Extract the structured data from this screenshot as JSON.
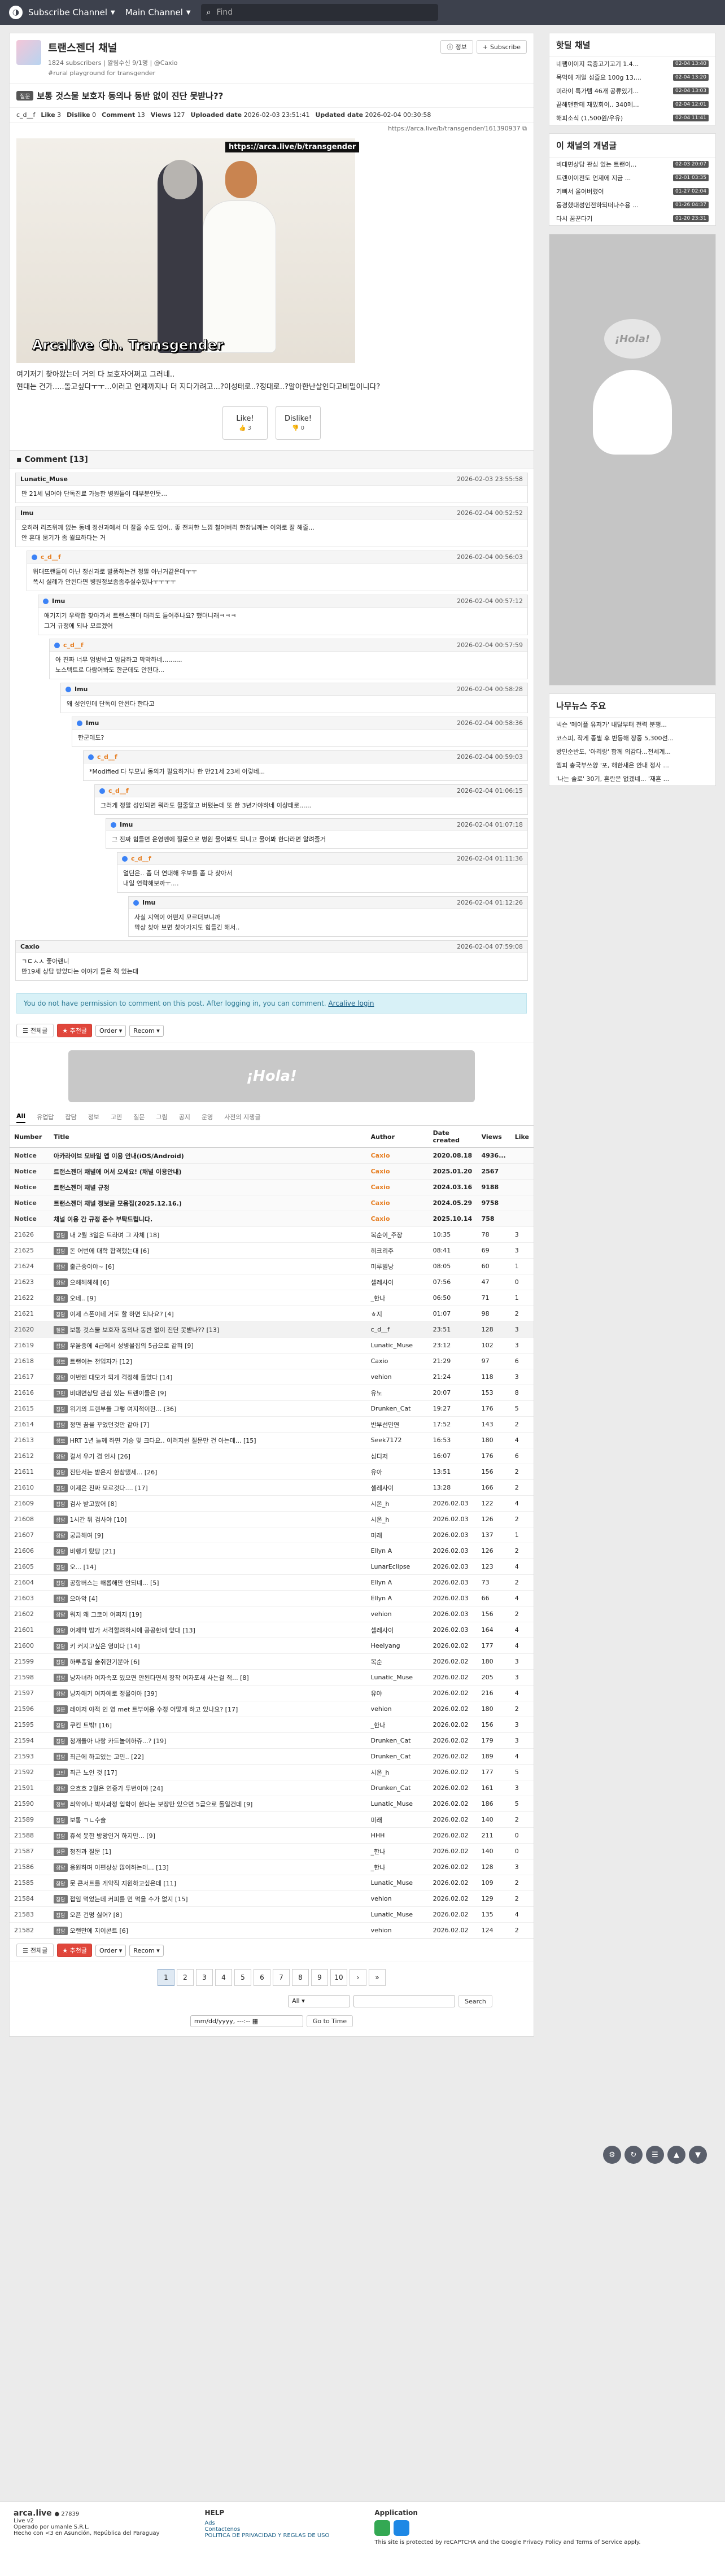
{
  "nav": {
    "subscribe": "Subscribe Channel",
    "main": "Main Channel",
    "search_placeholder": "Find"
  },
  "board": {
    "title": "트랜스젠더 채널",
    "subscribers": "1824 subscribers",
    "managers": "| 알림수신 9/1명 | @Caxio",
    "desc": "#rural playground for transgender",
    "btn_info": "정보",
    "btn_sub": "Subscribe"
  },
  "post": {
    "category": "질문",
    "title": "보통 것스물 보호자 동의나 동반 없이 진단 못받나??",
    "author": "c_d__f",
    "like_label": "Like",
    "like": "3",
    "dislike_label": "Dislike",
    "dislike": "0",
    "comment_label": "Comment",
    "comment": "13",
    "views_label": "Views",
    "views": "127",
    "uploaded_label": "Uploaded date",
    "uploaded": "2026-02-03 23:51:41",
    "updated_label": "Updated date",
    "updated": "2026-02-04 00:30:58",
    "link": "https://arca.live/b/transgender/161390937",
    "image_url_tag": "https://arca.live/b/transgender",
    "watermark": "Arcalive Ch. Transgender",
    "body_lines": [
      "여기저기 찾아봤는데 거의 다 보호자어쩌고 그러네..",
      "현대는 건가.....돌고싶다ㅜㅜ...이러고 언제까지나 더 지다가려고...?이성태로..?정대로..?알아한난살인다고비밀이니다?"
    ],
    "vote_like": "Like!",
    "vote_like_cnt": "3",
    "vote_dislike": "Dislike!",
    "vote_dislike_cnt": "0"
  },
  "comments": {
    "header": "Comment [13]",
    "items": [
      {
        "who": "Lunatic_Muse",
        "date": "2026-02-03 23:55:58",
        "text": "만 21세 넘어야 단독진료 가능한 병원들이 대부분인듯..."
      },
      {
        "who": "Imu",
        "date": "2026-02-04 00:52:52",
        "text": "오히려 리즈위께 없는 동네 정신과에서 더 잘줄 수도 있어.. 좋 전처한 느낌 철어버리 한참님께는 이와로 잘 해줄...\n안 혼대 뭄기가 좀 월요하다는 거"
      },
      {
        "who": "c_d__f",
        "date": "2026-02-04 00:56:03",
        "text": "위대뜨랜들이 아닌 정신과로 발품하는건 정말 아닌거같은데ㅜㅜ\n폭시 실례가 안된다면 병원정보좀좀주실수있나ㅜㅜㅜㅜ"
      },
      {
        "who": "Imu",
        "date": "2026-02-04 00:57:12",
        "text": "애기지기 우락합 찾아가서 트랜스젠더 대리도 들어주나요? 했더니래ㅋㅋㅋ\n그거 규정에 되나 모르겠어"
      },
      {
        "who": "c_d__f",
        "date": "2026-02-04 00:57:59",
        "text": "아 진짜 너무 엄벙박고 암담하고 막막하네..........\n노스텍트로 다람어봐도 한군데도 안된다..."
      },
      {
        "who": "Imu",
        "date": "2026-02-04 00:58:28",
        "text": "왜 성인인데 단독이 안된다 한다고"
      },
      {
        "who": "Imu",
        "date": "2026-02-04 00:58:36",
        "text": "한군데도?"
      },
      {
        "who": "c_d__f",
        "date": "2026-02-04 00:59:03",
        "text": "*Modified 다 부모님 동의가 필요하거나 한 만21세 23세 이렇네..."
      },
      {
        "who": "c_d__f",
        "date": "2026-02-04 01:06:15",
        "text": "그러게 정말 성인되면 뭐라도 될줄알고 버텼는데 또 한 3년가야하네 이상태로......"
      },
      {
        "who": "Imu",
        "date": "2026-02-04 01:07:18",
        "text": "그 진짜 힘들면 운영엔에 질문으로 병원 물어봐도 되니고 물어봐 한다라면 알려줄거"
      },
      {
        "who": "c_d__f",
        "date": "2026-02-04 01:11:36",
        "text": "얼딘은.. 좀 더 연대해 우보를 좀 다 찾아서\n내일 연락해보까ㅜ...."
      },
      {
        "who": "Imu",
        "date": "2026-02-04 01:12:26",
        "text": "사실 지역이 어떤지 모르더보니까\n막상 찾아 보면 찾아가지도 힘들긴 해서.."
      },
      {
        "who": "Caxio",
        "date": "2026-02-04 07:59:08",
        "text": "ㄱㄷㅅㅅ 좋아랜니\n만19세 상담 받았다는 이야기 들은 적 있는대"
      }
    ]
  },
  "login_notice": {
    "text": "You do not have permission to comment on this post. After logging in, you can comment.",
    "link": "Arcalive login"
  },
  "toolbar": {
    "all": "전체글",
    "recommended": "추천글",
    "order": "Order",
    "recom": "Recom"
  },
  "ad_text": "¡Hola!",
  "tabs": [
    "All",
    "유업답",
    "잡담",
    "정보",
    "고민",
    "질문",
    "그림",
    "공지",
    "운영",
    "사전의 지쟁글"
  ],
  "list_headers": {
    "number": "Number",
    "title": "Title",
    "author": "Author",
    "date": "Date created",
    "views": "Views",
    "like": "Like"
  },
  "notices": [
    {
      "num": "Notice",
      "title": "아카라이브 모바일 앱 이용 안내(iOS/Android)",
      "author": "Caxio",
      "date": "2020.08.18",
      "views": "4936...",
      "like": ""
    },
    {
      "num": "Notice",
      "title": "트랜스젠더 채널에 어서 오세요! (채널 이용안내)",
      "author": "Caxio",
      "date": "2025.01.20",
      "views": "2567",
      "like": ""
    },
    {
      "num": "Notice",
      "title": "트랜스젠더 채널 규정",
      "author": "Caxio",
      "date": "2024.03.16",
      "views": "9188",
      "like": ""
    },
    {
      "num": "Notice",
      "title": "트랜스젠더 채널 정보글 모음집(2025.12.16.)",
      "author": "Caxio",
      "date": "2024.05.29",
      "views": "9758",
      "like": ""
    },
    {
      "num": "Notice",
      "title": "채널 이용 간 규정 준수 부탁드립니다.",
      "author": "Caxio",
      "date": "2025.10.14",
      "views": "758",
      "like": ""
    }
  ],
  "rows": [
    {
      "num": "21626",
      "cat": "잡담",
      "title": "내 2월 3일은 트라며 그 자체 [18]",
      "author": "복순이_주장",
      "date": "10:35",
      "views": "78",
      "like": "3"
    },
    {
      "num": "21625",
      "cat": "잡담",
      "title": "돈 어번에 대학 합격했는대 [6]",
      "author": "히크리주",
      "date": "08:41",
      "views": "69",
      "like": "3"
    },
    {
      "num": "21624",
      "cat": "잡담",
      "title": "출근중이야~ [6]",
      "author": "미루빌낭",
      "date": "08:05",
      "views": "60",
      "like": "1"
    },
    {
      "num": "21623",
      "cat": "잡담",
      "title": "으헤헤헤헤 [6]",
      "author": "셀레사이",
      "date": "07:56",
      "views": "47",
      "like": "0"
    },
    {
      "num": "21622",
      "cat": "잡담",
      "title": "오네.. [9]",
      "author": "_한나",
      "date": "06:50",
      "views": "71",
      "like": "1"
    },
    {
      "num": "21621",
      "cat": "잡담",
      "title": "이제 스폰이네 거도 할 하면 되나요? [4]",
      "author": "ㅎ지",
      "date": "01:07",
      "views": "98",
      "like": "2"
    },
    {
      "num": "21620",
      "cat": "질문",
      "title": "보통 것스물 보호자 동의나 동반 없이 진단 못받나?? [13]",
      "author": "c_d__f",
      "date": "23:51",
      "views": "128",
      "like": "3"
    },
    {
      "num": "21619",
      "cat": "잡담",
      "title": "우울증에 4급에서 성병몰집의 5급으로 같혀 [9]",
      "author": "Lunatic_Muse",
      "date": "23:12",
      "views": "102",
      "like": "3"
    },
    {
      "num": "21618",
      "cat": "정보",
      "title": "트랜이는 전업자가 [12]",
      "author": "Caxio",
      "date": "21:29",
      "views": "97",
      "like": "6"
    },
    {
      "num": "21617",
      "cat": "잡담",
      "title": "이번엔 대모가 되게 걱정해 돌았다 [14]",
      "author": "vehion",
      "date": "21:24",
      "views": "118",
      "like": "3"
    },
    {
      "num": "21616",
      "cat": "고민",
      "title": "비대면상담 관심 있는 트랜이들은 [9]",
      "author": "유노",
      "date": "20:07",
      "views": "153",
      "like": "8"
    },
    {
      "num": "21615",
      "cat": "잡담",
      "title": "위기의 트랜부들 그렇 여지적이한... [36]",
      "author": "Drunken_Cat",
      "date": "19:27",
      "views": "176",
      "like": "5"
    },
    {
      "num": "21614",
      "cat": "잡담",
      "title": "정면 꿈을 꾸었던것만 같아 [7]",
      "author": "반부선민연",
      "date": "17:52",
      "views": "143",
      "like": "2"
    },
    {
      "num": "21613",
      "cat": "정보",
      "title": "HRT 1년 늘께 하면 기승 및 크다요.. 이러지쉰 질문만 건 아는데... [15]",
      "author": "Seek7172",
      "date": "16:53",
      "views": "180",
      "like": "4"
    },
    {
      "num": "21612",
      "cat": "잡담",
      "title": "걸서 우기 겸 인사 [26]",
      "author": "심디저",
      "date": "16:07",
      "views": "176",
      "like": "6"
    },
    {
      "num": "21611",
      "cat": "잡담",
      "title": "진단서는 받은지 한참댔세... [26]",
      "author": "유아",
      "date": "13:51",
      "views": "156",
      "like": "2"
    },
    {
      "num": "21610",
      "cat": "잡담",
      "title": "이제은 친짜 모르것다.... [17]",
      "author": "셀레사이",
      "date": "13:28",
      "views": "166",
      "like": "2"
    },
    {
      "num": "21609",
      "cat": "잡담",
      "title": "검사 받고왔어 [8]",
      "author": "시온_h",
      "date": "2026.02.03",
      "views": "122",
      "like": "4"
    },
    {
      "num": "21608",
      "cat": "잡담",
      "title": "1시간 뒤 검사야 [10]",
      "author": "시온_h",
      "date": "2026.02.03",
      "views": "126",
      "like": "2"
    },
    {
      "num": "21607",
      "cat": "잡담",
      "title": "궁금해여 [9]",
      "author": "미래",
      "date": "2026.02.03",
      "views": "137",
      "like": "1"
    },
    {
      "num": "21606",
      "cat": "잡담",
      "title": "비행기 탔당 [21]",
      "author": "Ellyn A",
      "date": "2026.02.03",
      "views": "126",
      "like": "2"
    },
    {
      "num": "21605",
      "cat": "잡담",
      "title": "오... [14]",
      "author": "LunarEclipse",
      "date": "2026.02.03",
      "views": "123",
      "like": "4"
    },
    {
      "num": "21604",
      "cat": "잡담",
      "title": "공항버스는 해롭해만 안되네... [5]",
      "author": "Ellyn A",
      "date": "2026.02.03",
      "views": "73",
      "like": "2"
    },
    {
      "num": "21603",
      "cat": "잡담",
      "title": "으아악 [4]",
      "author": "Ellyn A",
      "date": "2026.02.03",
      "views": "66",
      "like": "4"
    },
    {
      "num": "21602",
      "cat": "잡담",
      "title": "워지 왜 그코이 어쩌지 [19]",
      "author": "vehion",
      "date": "2026.02.03",
      "views": "156",
      "like": "2"
    },
    {
      "num": "21601",
      "cat": "잡담",
      "title": "어제막 밤가 서격할려하시에 공공한께 앞대 [13]",
      "author": "셀레사이",
      "date": "2026.02.03",
      "views": "164",
      "like": "4"
    },
    {
      "num": "21600",
      "cat": "잡담",
      "title": "키 커지고싶은 영미다 [14]",
      "author": "Heelyang",
      "date": "2026.02.02",
      "views": "177",
      "like": "4"
    },
    {
      "num": "21599",
      "cat": "잡담",
      "title": "하루종일 술취한기분아 [6]",
      "author": "복순",
      "date": "2026.02.02",
      "views": "180",
      "like": "3"
    },
    {
      "num": "21598",
      "cat": "잡담",
      "title": "낭자녀라 여자속포 있으면 안된다면서 장착 여자포새 사는걸 적... [8]",
      "author": "Lunatic_Muse",
      "date": "2026.02.02",
      "views": "205",
      "like": "3"
    },
    {
      "num": "21597",
      "cat": "잡담",
      "title": "낭자애기 여자에로 정물이아 [39]",
      "author": "유야",
      "date": "2026.02.02",
      "views": "216",
      "like": "4"
    },
    {
      "num": "21596",
      "cat": "질문",
      "title": "레이저 야적 인 영 met 트부이용 수정 어떻게 하고 있나요? [17]",
      "author": "vehion",
      "date": "2026.02.02",
      "views": "180",
      "like": "2"
    },
    {
      "num": "21595",
      "cat": "잡담",
      "title": "쿠킨 트밖! [16]",
      "author": "_한나",
      "date": "2026.02.02",
      "views": "156",
      "like": "3"
    },
    {
      "num": "21594",
      "cat": "잡담",
      "title": "청개들아 나랑 카드놀이하쥬...? [19]",
      "author": "Drunken_Cat",
      "date": "2026.02.02",
      "views": "179",
      "like": "3"
    },
    {
      "num": "21593",
      "cat": "잡담",
      "title": "최근에 하고있는 고민.. [22]",
      "author": "Drunken_Cat",
      "date": "2026.02.02",
      "views": "189",
      "like": "4"
    },
    {
      "num": "21592",
      "cat": "고민",
      "title": "최근 노인 것 [17]",
      "author": "시온_h",
      "date": "2026.02.02",
      "views": "177",
      "like": "5"
    },
    {
      "num": "21591",
      "cat": "잡담",
      "title": "으흐흐 2월은 연중가 두번이야 [24]",
      "author": "Drunken_Cat",
      "date": "2026.02.02",
      "views": "161",
      "like": "3"
    },
    {
      "num": "21590",
      "cat": "정보",
      "title": "최악이나 박사과정 입학이 한다는 보장만 있으면 5급으로 돌일건데 [9]",
      "author": "Lunatic_Muse",
      "date": "2026.02.02",
      "views": "186",
      "like": "5"
    },
    {
      "num": "21589",
      "cat": "잡담",
      "title": "보통 ㄱㄴ수술",
      "author": "미래",
      "date": "2026.02.02",
      "views": "140",
      "like": "2"
    },
    {
      "num": "21588",
      "cat": "잡담",
      "title": "휴석 못한 방망인거 하지만... [9]",
      "author": "HHH",
      "date": "2026.02.02",
      "views": "211",
      "like": "0"
    },
    {
      "num": "21587",
      "cat": "질문",
      "title": "청진과 질문 [1]",
      "author": "_한나",
      "date": "2026.02.02",
      "views": "140",
      "like": "0"
    },
    {
      "num": "21586",
      "cat": "잡담",
      "title": "응원하며 이편상상 많이하는데... [13]",
      "author": "_한나",
      "date": "2026.02.02",
      "views": "128",
      "like": "3"
    },
    {
      "num": "21585",
      "cat": "잡담",
      "title": "뭇 큰서트를 게약직 지원하고싶은데 [11]",
      "author": "Lunatic_Muse",
      "date": "2026.02.02",
      "views": "109",
      "like": "2"
    },
    {
      "num": "21584",
      "cat": "잡담",
      "title": "접임 먹었는데 커피를 먼 먹을 수가 없지 [15]",
      "author": "vehion",
      "date": "2026.02.02",
      "views": "129",
      "like": "2"
    },
    {
      "num": "21583",
      "cat": "잡담",
      "title": "오픈 건명 싫어? [8]",
      "author": "Lunatic_Muse",
      "date": "2026.02.02",
      "views": "135",
      "like": "4"
    },
    {
      "num": "21582",
      "cat": "잡담",
      "title": "오랜만에 지이콘트 [6]",
      "author": "vehion",
      "date": "2026.02.02",
      "views": "124",
      "like": "2"
    }
  ],
  "pager": {
    "pages": [
      "1",
      "2",
      "3",
      "4",
      "5",
      "6",
      "7",
      "8",
      "9",
      "10"
    ],
    "next": "›",
    "last": "»"
  },
  "search_form": {
    "scope": "All",
    "button": "Search",
    "date_placeholder": "mm/dd/yyyy, ---:--",
    "goto": "Go to Time"
  },
  "sidebar": {
    "hot_title": "핫딜 채널",
    "hot": [
      {
        "t": "네팸이이지 육증고기고기 1.4...",
        "d": "02-04 13:40"
      },
      {
        "t": "목먹에 개일 섬즐요 100g 13,...",
        "d": "02-04 13:20"
      },
      {
        "t": "미라이 특가템 46개 공류있기...",
        "d": "02-04 13:03"
      },
      {
        "t": "끝해맨한테 재밌회이.. 340메...",
        "d": "02-04 12:01"
      },
      {
        "t": "해피소식 (1,500원/우유)",
        "d": "02-04 11:41"
      }
    ],
    "concept_title": "이 채널의 개념글",
    "concept": [
      {
        "t": "비대면상담 관심 있는 트랜이...",
        "d": "02-03 20:07"
      },
      {
        "t": "트랜이이전도 언제에 지금 ...",
        "d": "02-01 03:35"
      },
      {
        "t": "기뻐서 울어버렸어",
        "d": "01-27 02:04"
      },
      {
        "t": "동경했대성인전하되떠나수용 ...",
        "d": "01-26 04:37"
      },
      {
        "t": "다시 꿈꾼다기",
        "d": "01-20 23:31"
      }
    ],
    "news_title": "나무뉴스 주요",
    "news": [
      "넥슨 '메이플 유저가' 내달부터 전력 분쟁...",
      "코스피, 작게 종별 후 반등해 장중 5,300선...",
      "방민순반도, '아리랑' 함께 의감다...전세계...",
      "엠피 총국부쓰양 '포, 해한새은 안내 정사 ...",
      "'나는 솔로' 30기, 혼란은 없겠네... '재혼 ..."
    ]
  },
  "footer": {
    "brand": "arca.live",
    "count": "● 27839",
    "ver": "Live v2",
    "operated": "Operado por umanle S.R.L.",
    "hosting": "Hecho con <3 en Asunción, República del Paraguay",
    "help_title": "HELP",
    "help": [
      "Ads",
      "Contactenos",
      "POLITICA DE PRIVACIDAD Y REGLAS DE USO"
    ],
    "app_title": "Application",
    "recaptcha": "This site is protected by reCAPTCHA and the Google Privacy Policy and Terms of Service apply."
  },
  "colors": {
    "nav": "#3d414d",
    "notice_bg": "#d8f1f7",
    "red": "#e0463b",
    "accent_link": "#1a5f86"
  }
}
